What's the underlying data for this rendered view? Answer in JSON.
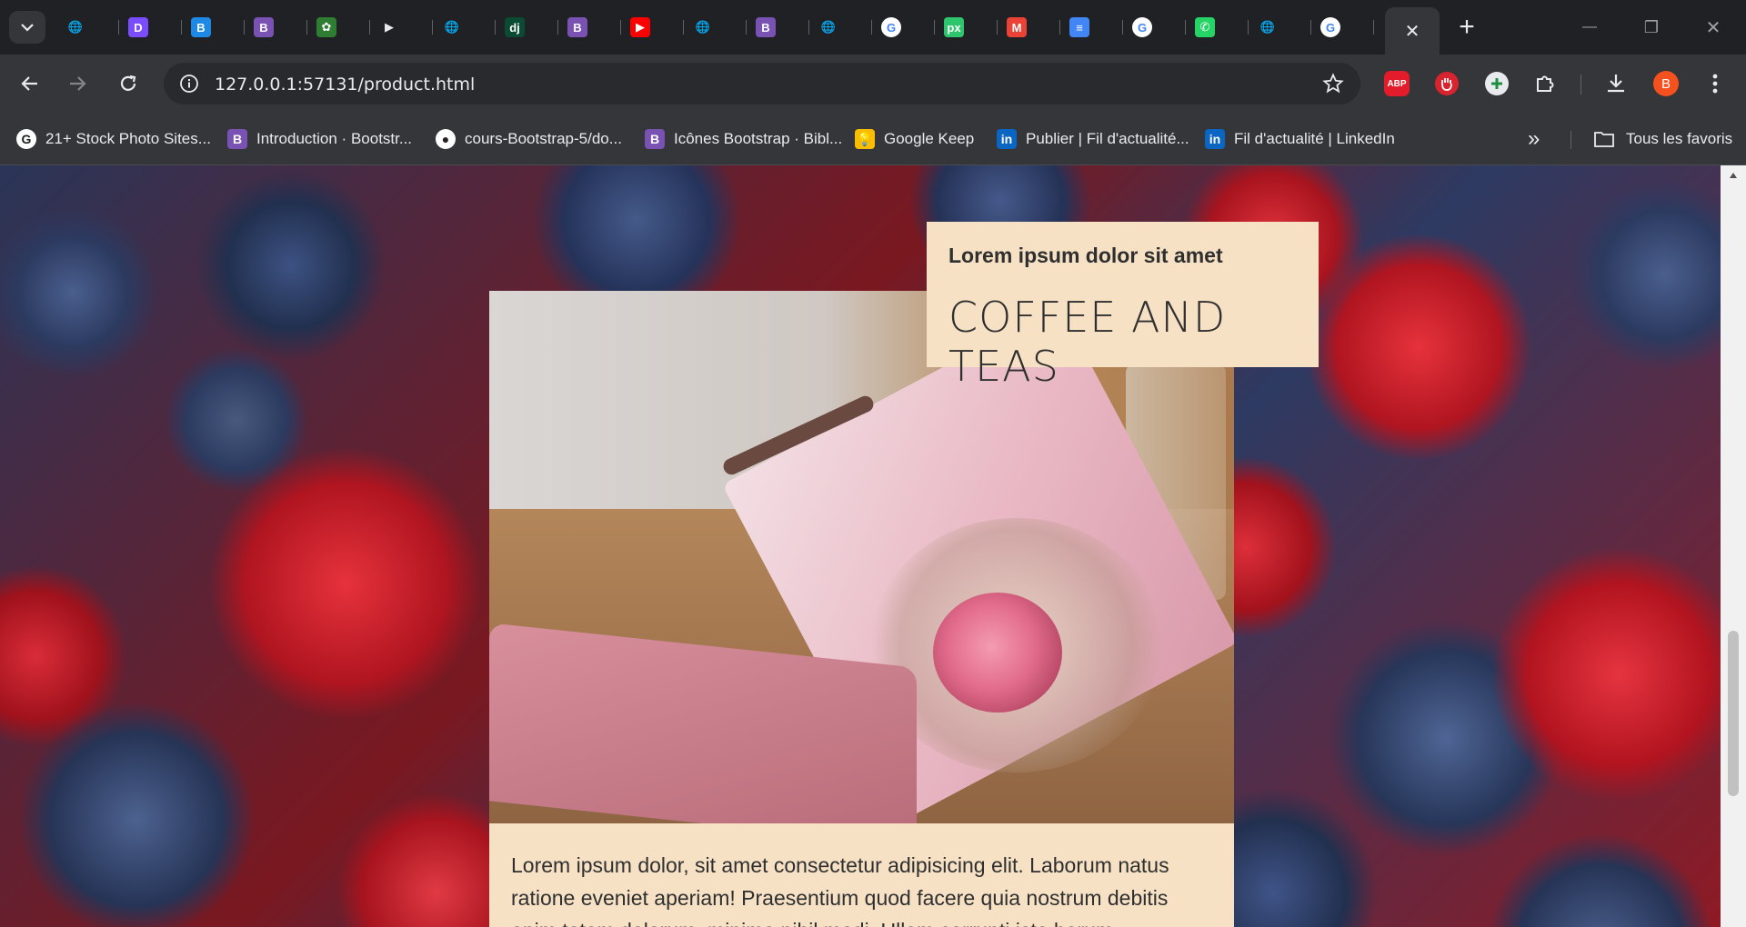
{
  "browser": {
    "tabs": [
      {
        "icon": "globe-icon",
        "color": "#9aa0a6",
        "glyph": "🌐"
      },
      {
        "icon": "arc-icon",
        "color": "#7c4dff",
        "glyph": "D"
      },
      {
        "icon": "bootstrap-icon",
        "color": "#1e88e5",
        "glyph": "B"
      },
      {
        "icon": "bootstrap-icon",
        "color": "#7952b3",
        "glyph": "B"
      },
      {
        "icon": "leaf-icon",
        "color": "#2e7d32",
        "glyph": "✿"
      },
      {
        "icon": "play-icon",
        "color": "#202124",
        "glyph": "▶"
      },
      {
        "icon": "globe-icon",
        "color": "#9aa0a6",
        "glyph": "🌐"
      },
      {
        "icon": "django-icon",
        "color": "#0c4b33",
        "glyph": "dj"
      },
      {
        "icon": "bootstrap-icon",
        "color": "#7952b3",
        "glyph": "B"
      },
      {
        "icon": "youtube-icon",
        "color": "#ff0000",
        "glyph": "▶"
      },
      {
        "icon": "globe-icon",
        "color": "#9aa0a6",
        "glyph": "🌐"
      },
      {
        "icon": "bootstrap-icon",
        "color": "#7952b3",
        "glyph": "B"
      },
      {
        "icon": "globe-icon",
        "color": "#9aa0a6",
        "glyph": "🌐"
      },
      {
        "icon": "google-icon",
        "color": "#ffffff",
        "glyph": "G"
      },
      {
        "icon": "pixabay-icon",
        "color": "#2ec66d",
        "glyph": "px"
      },
      {
        "icon": "gmail-icon",
        "color": "#ea4335",
        "glyph": "M"
      },
      {
        "icon": "docs-icon",
        "color": "#4285f4",
        "glyph": "≡"
      },
      {
        "icon": "google-icon",
        "color": "#ffffff",
        "glyph": "G"
      },
      {
        "icon": "whatsapp-icon",
        "color": "#25d366",
        "glyph": "✆"
      },
      {
        "icon": "globe-icon",
        "color": "#9aa0a6",
        "glyph": "🌐"
      },
      {
        "icon": "google-icon",
        "color": "#ffffff",
        "glyph": "G"
      }
    ],
    "active_tab_close": "✕",
    "new_tab": "+",
    "window_controls": {
      "minimize": "—",
      "restore": "❐",
      "close": "✕"
    },
    "url": "127.0.0.1:57131/product.html",
    "profile_initial": "B",
    "extensions": {
      "abp": "ABP"
    }
  },
  "bookmarks": {
    "items": [
      {
        "label": "21+ Stock Photo Sites...",
        "icon": "google-icon",
        "glyph": "G",
        "color": "#ffffff"
      },
      {
        "label": "Introduction · Bootstr...",
        "icon": "bootstrap-icon",
        "glyph": "B",
        "color": "#7952b3"
      },
      {
        "label": "cours-Bootstrap-5/do...",
        "icon": "github-icon",
        "glyph": "●",
        "color": "#ffffff"
      },
      {
        "label": "Icônes Bootstrap · Bibl...",
        "icon": "bootstrap-icon",
        "glyph": "B",
        "color": "#7952b3"
      },
      {
        "label": "Google Keep",
        "icon": "keep-icon",
        "glyph": "💡",
        "color": "#fbbc04"
      },
      {
        "label": "Publier | Fil d'actualité...",
        "icon": "linkedin-icon",
        "glyph": "in",
        "color": "#0a66c2"
      },
      {
        "label": "Fil d'actualité | LinkedIn",
        "icon": "linkedin-icon",
        "glyph": "in",
        "color": "#0a66c2"
      }
    ],
    "overflow": "»",
    "all_bookmarks": "Tous les favoris"
  },
  "page": {
    "headline_sub": "Lorem ipsum dolor sit amet",
    "headline_main": "COFFEE AND TEAS",
    "description": "Lorem ipsum dolor, sit amet consectetur adipisicing elit. Laborum natus ratione eveniet aperiam! Praesentium quod facere quia nostrum debitis enim totam dolorum, minima nihil modi. Ullam corrupti iste harum."
  }
}
